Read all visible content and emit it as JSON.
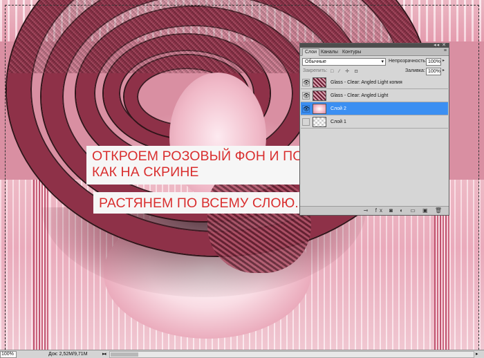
{
  "annotations": {
    "line1": "ОТКРОЕМ РОЗОВЫЙ ФОН И ПОМЕСТИМ",
    "line2": "КАК НА СКРИНЕ",
    "line3": "РАСТЯНЕМ ПО ВСЕМУ СЛОЮ.",
    "color": "#d92f2f"
  },
  "layers_panel": {
    "tabs": [
      "Слои",
      "Каналы",
      "Контуры"
    ],
    "active_tab": "Слои",
    "title_controls": "◂◂ ✕",
    "menu_icon": "≡",
    "blend_mode": "Обычные",
    "opacity_label": "Непрозрачность:",
    "opacity_value": "100%",
    "lock_label": "Закрепить:",
    "lock_icons": "□ ∕ ✛ ◘",
    "fill_label": "Заливка:",
    "fill_value": "100%",
    "layers": [
      {
        "name": "Glass - Clear: Angled Light копия",
        "visible": true,
        "selected": false,
        "thumb": "glass"
      },
      {
        "name": "Glass - Clear: Angled Light",
        "visible": true,
        "selected": false,
        "thumb": "glass"
      },
      {
        "name": "Слой 2",
        "visible": true,
        "selected": true,
        "thumb": "pink"
      },
      {
        "name": "Слой 1",
        "visible": false,
        "selected": false,
        "thumb": "transparent"
      }
    ],
    "footer_icons": "⊸ fx ◙ ◐ ▭ ▣ 🗑"
  },
  "statusbar": {
    "zoom": "100%",
    "doc_info": "Док: 2,52M/9,71M",
    "arrow": "▸",
    "scroll_left": "◂",
    "scroll_right": "▸"
  },
  "colors": {
    "selection_blue": "#3b8ff2",
    "ring": "#8e3148",
    "background_pink": "#f3c3cf"
  }
}
